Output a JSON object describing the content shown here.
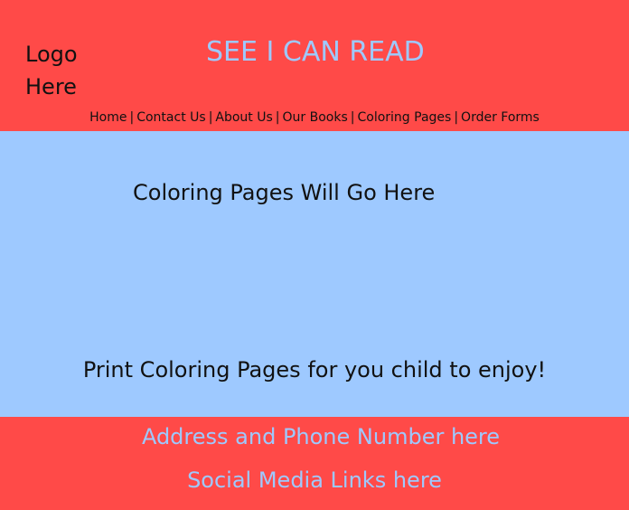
{
  "header": {
    "logo_line1": "Logo",
    "logo_line2": "Here",
    "title": "SEE I CAN READ",
    "colors": {
      "background": "#ff4a48",
      "title": "#9ec9ff",
      "text": "#111111"
    }
  },
  "nav": {
    "items": [
      {
        "label": "Home"
      },
      {
        "label": "Contact Us"
      },
      {
        "label": "About Us"
      },
      {
        "label": "Our Books"
      },
      {
        "label": "Coloring Pages"
      },
      {
        "label": "Order Forms"
      }
    ],
    "separator": "|"
  },
  "main": {
    "heading": "Coloring Pages Will Go Here",
    "subtext": "Print Coloring Pages for you child to enjoy!",
    "background": "#9ec9ff"
  },
  "footer": {
    "address": "Address and Phone Number here",
    "social": "Social Media Links here",
    "background": "#ff4a48",
    "text_color": "#9ec9ff"
  }
}
